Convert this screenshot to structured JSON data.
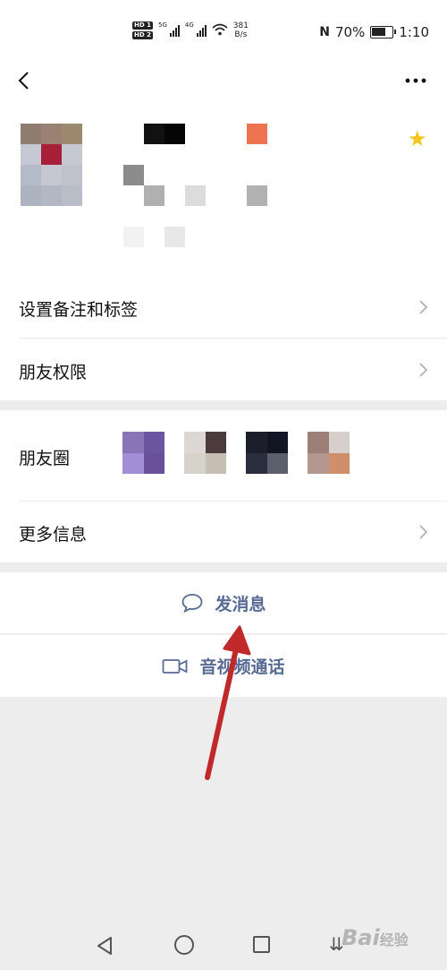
{
  "status_bar": {
    "hd1": "HD 1",
    "hd2": "HD 2",
    "net1": "5G",
    "net2": "4G",
    "speed_value": "381",
    "speed_unit": "B/s",
    "battery": "70%",
    "battery_level": 0.7,
    "time": "1:10"
  },
  "header": {
    "back_icon": "chevron-left-icon",
    "more_icon": "ellipsis-icon"
  },
  "profile": {
    "starred": true,
    "star_color": "#f5c517"
  },
  "menu": {
    "remark_tags": "设置备注和标签",
    "friend_permissions": "朋友权限",
    "moments": "朋友圈",
    "more_info": "更多信息"
  },
  "actions": {
    "send_message": "发消息",
    "video_call": "音视频通话",
    "accent_color": "#576b95"
  },
  "watermark": {
    "brand": "Bai",
    "brand2": "经验"
  },
  "annotation": {
    "arrow_color": "#c0282a"
  }
}
